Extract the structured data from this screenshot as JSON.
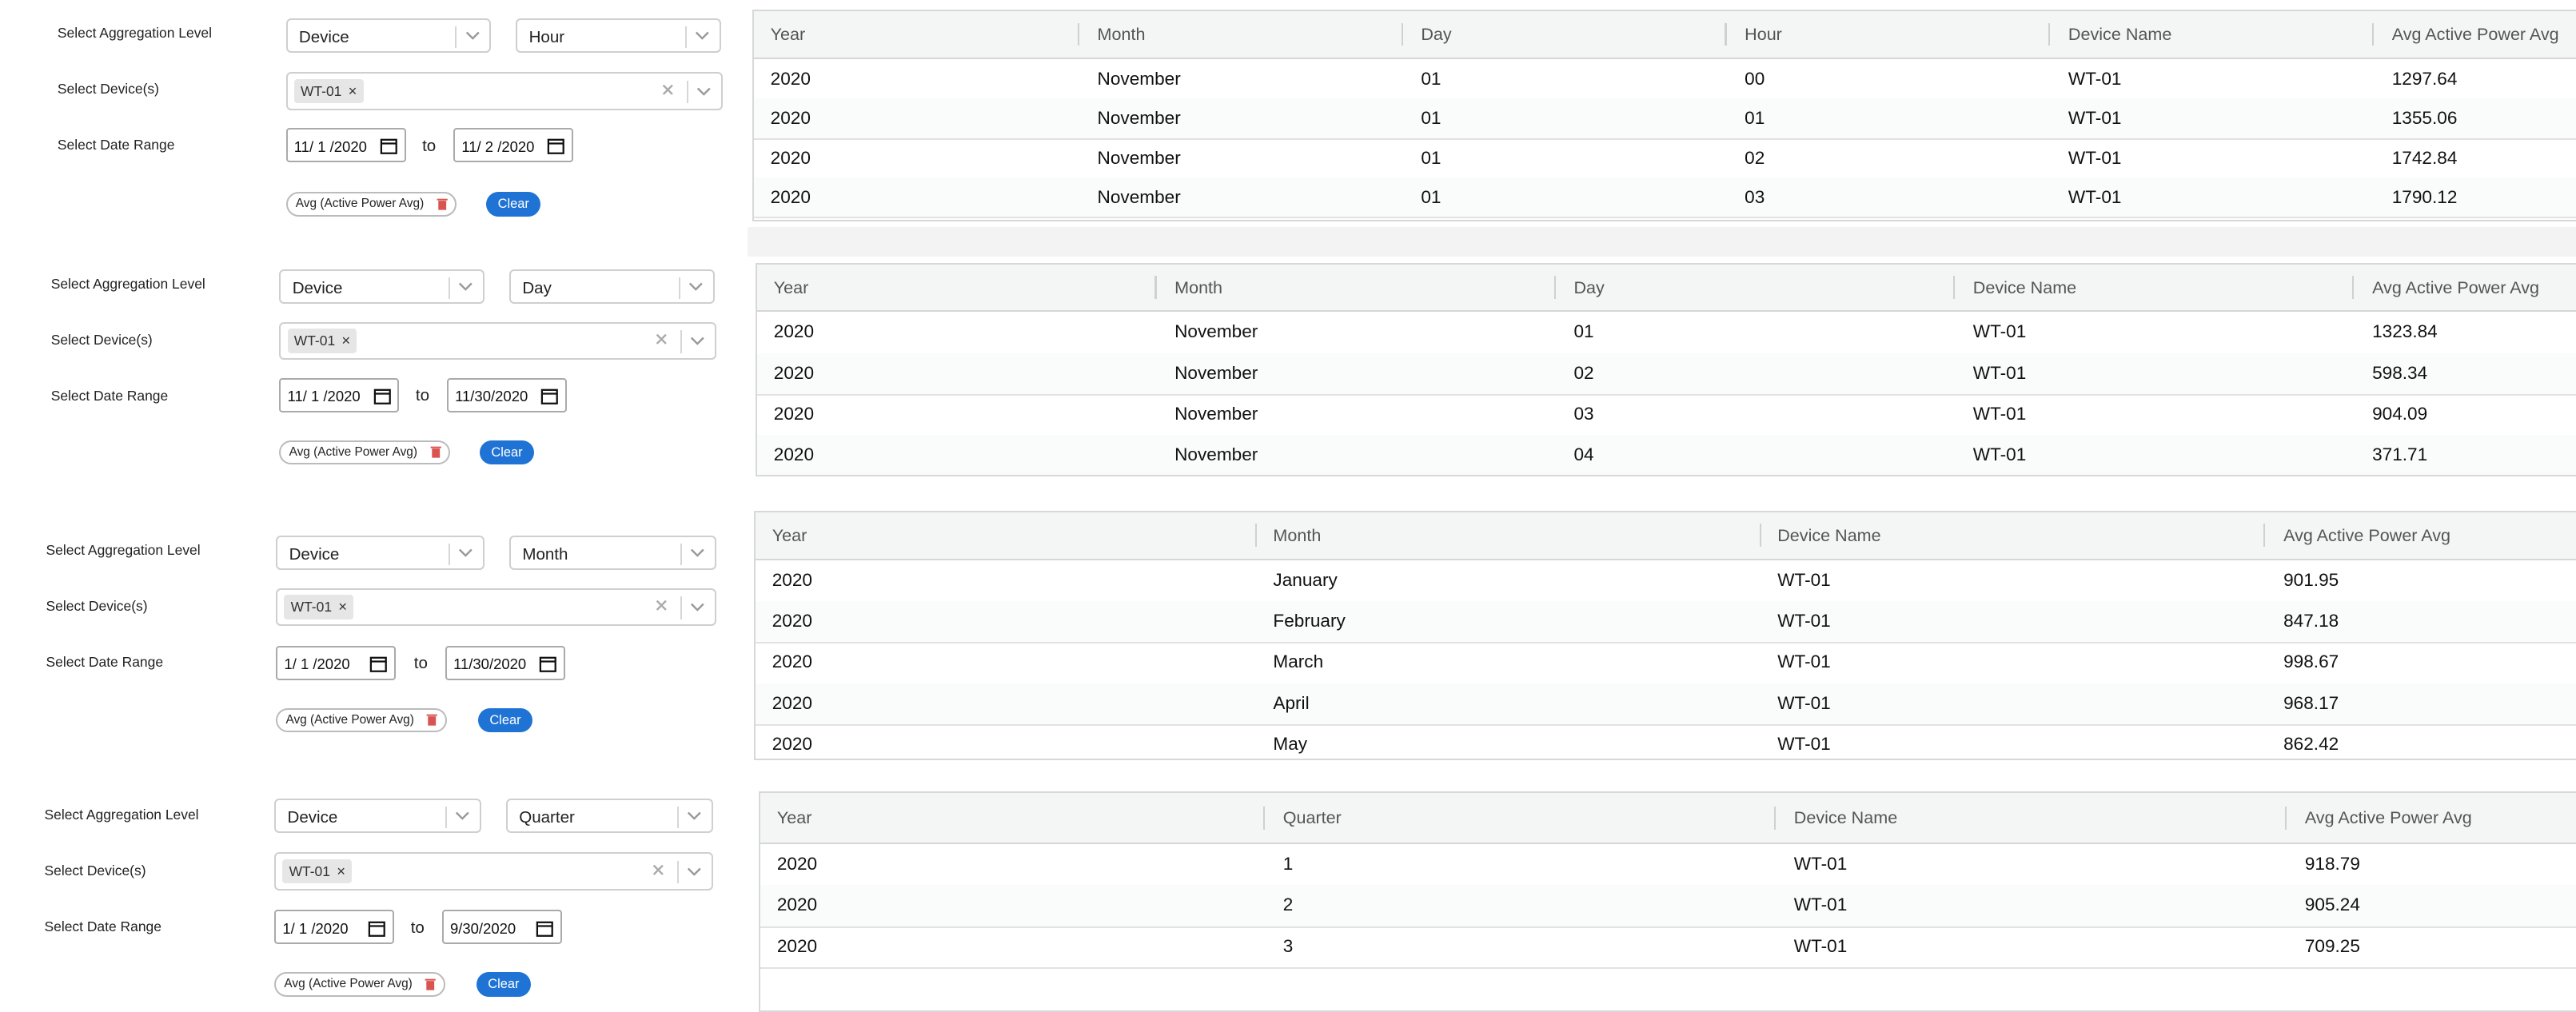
{
  "labels": {
    "aggregation_level": "Select Aggregation Level",
    "devices": "Select Device(s)",
    "date_range": "Select Date Range",
    "to": "to",
    "metric_pill": "Avg (Active Power Avg)",
    "clear_button": "Clear"
  },
  "icons": {
    "chevron": "chevron-down-icon",
    "clear": "close-icon",
    "calendar": "calendar-icon",
    "trash": "trash-icon"
  },
  "colors": {
    "accent": "#1f73d4",
    "trash": "#d9534f"
  },
  "panels": [
    {
      "aggregation": "Device",
      "granularity": "Hour",
      "device_chip": "WT-01",
      "date_from": "11/ 1 /2020",
      "date_to": "11/ 2 /2020",
      "columns": [
        "Year",
        "Month",
        "Day",
        "Hour",
        "Device Name",
        "Avg Active Power Avg"
      ],
      "rows": [
        [
          "2020",
          "November",
          "01",
          "00",
          "WT-01",
          "1297.64"
        ],
        [
          "2020",
          "November",
          "01",
          "01",
          "WT-01",
          "1355.06"
        ],
        [
          "2020",
          "November",
          "01",
          "02",
          "WT-01",
          "1742.84"
        ],
        [
          "2020",
          "November",
          "01",
          "03",
          "WT-01",
          "1790.12"
        ]
      ]
    },
    {
      "aggregation": "Device",
      "granularity": "Day",
      "device_chip": "WT-01",
      "date_from": "11/ 1 /2020",
      "date_to": "11/30/2020",
      "columns": [
        "Year",
        "Month",
        "Day",
        "Device Name",
        "Avg Active Power Avg"
      ],
      "rows": [
        [
          "2020",
          "November",
          "01",
          "WT-01",
          "1323.84"
        ],
        [
          "2020",
          "November",
          "02",
          "WT-01",
          "598.34"
        ],
        [
          "2020",
          "November",
          "03",
          "WT-01",
          "904.09"
        ],
        [
          "2020",
          "November",
          "04",
          "WT-01",
          "371.71"
        ]
      ]
    },
    {
      "aggregation": "Device",
      "granularity": "Month",
      "device_chip": "WT-01",
      "date_from": "1/ 1 /2020",
      "date_to": "11/30/2020",
      "columns": [
        "Year",
        "Month",
        "Device Name",
        "Avg Active Power Avg"
      ],
      "rows": [
        [
          "2020",
          "January",
          "WT-01",
          "901.95"
        ],
        [
          "2020",
          "February",
          "WT-01",
          "847.18"
        ],
        [
          "2020",
          "March",
          "WT-01",
          "998.67"
        ],
        [
          "2020",
          "April",
          "WT-01",
          "968.17"
        ],
        [
          "2020",
          "May",
          "WT-01",
          "862.42"
        ]
      ]
    },
    {
      "aggregation": "Device",
      "granularity": "Quarter",
      "device_chip": "WT-01",
      "date_from": "1/ 1 /2020",
      "date_to": "9/30/2020",
      "columns": [
        "Year",
        "Quarter",
        "Device Name",
        "Avg Active Power Avg"
      ],
      "rows": [
        [
          "2020",
          "1",
          "WT-01",
          "918.79"
        ],
        [
          "2020",
          "2",
          "WT-01",
          "905.24"
        ],
        [
          "2020",
          "3",
          "WT-01",
          "709.25"
        ]
      ]
    }
  ]
}
